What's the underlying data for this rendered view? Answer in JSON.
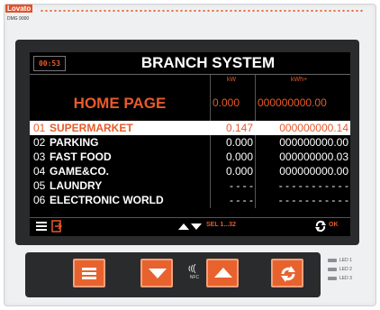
{
  "brand": {
    "logo": "Lovato",
    "model": "DMG 9000",
    "accent": "#e85a2a"
  },
  "screen": {
    "clock": "00:53",
    "title": "BRANCH SYSTEM",
    "col_kw": "kW",
    "col_kwh": "kWh+",
    "home_label": "HOME PAGE",
    "home_kw": "0.000",
    "home_kwh": "000000000.00",
    "rows": [
      {
        "idx": "01",
        "name": "SUPERMARKET",
        "kw": "0.147",
        "kwh": "000000000.14",
        "selected": true
      },
      {
        "idx": "02",
        "name": "PARKING",
        "kw": "0.000",
        "kwh": "000000000.00"
      },
      {
        "idx": "03",
        "name": "FAST FOOD",
        "kw": "0.000",
        "kwh": "000000000.03"
      },
      {
        "idx": "04",
        "name": "GAME&CO.",
        "kw": "0.000",
        "kwh": "000000000.00"
      },
      {
        "idx": "05",
        "name": "LAUNDRY",
        "kw": "- - - -",
        "kwh": "- - - - - - - - - - -"
      },
      {
        "idx": "06",
        "name": "ELECTRONIC WORLD",
        "kw": "- - - -",
        "kwh": "- - - - - - - - - - -"
      }
    ],
    "footer": {
      "sel_label": "SEL 1...32",
      "ok_label": "OK"
    }
  },
  "keypad": {
    "icons": [
      "menu-icon",
      "arrow-down-icon",
      "arrow-up-icon",
      "refresh-icon"
    ],
    "nfc_label": "NFC"
  },
  "leds": [
    "LED 1",
    "LED 2",
    "LED 3"
  ]
}
